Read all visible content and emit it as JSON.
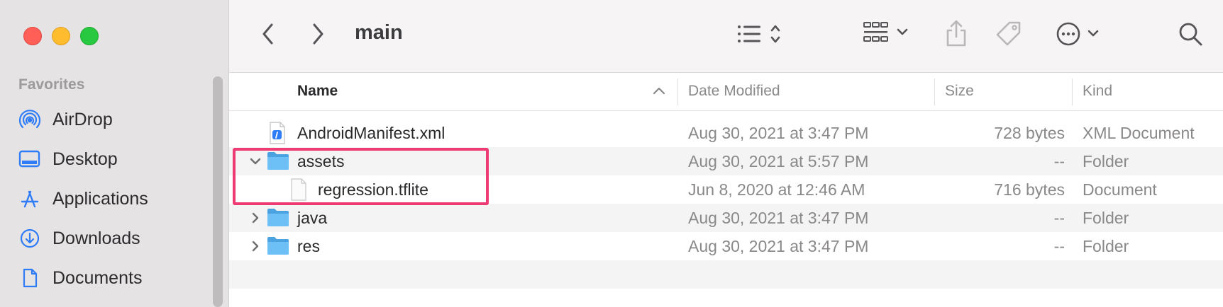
{
  "window": {
    "title": "main"
  },
  "sidebar": {
    "section_title": "Favorites",
    "items": [
      {
        "label": "AirDrop",
        "icon": "airdrop-icon"
      },
      {
        "label": "Desktop",
        "icon": "desktop-icon"
      },
      {
        "label": "Applications",
        "icon": "applications-icon"
      },
      {
        "label": "Downloads",
        "icon": "downloads-icon"
      },
      {
        "label": "Documents",
        "icon": "documents-icon"
      }
    ]
  },
  "toolbar": {
    "back_icon": "chevron-left-icon",
    "forward_icon": "chevron-right-icon",
    "view_icon": "list-view-icon",
    "group_icon": "group-icon",
    "share_icon": "share-icon",
    "tag_icon": "tag-icon",
    "more_icon": "more-icon",
    "search_icon": "search-icon"
  },
  "columns": {
    "name": "Name",
    "date_modified": "Date Modified",
    "size": "Size",
    "kind": "Kind"
  },
  "files": [
    {
      "name": "AndroidManifest.xml",
      "date": "Aug 30, 2021 at 3:47 PM",
      "size": "728 bytes",
      "kind": "XML Document",
      "type": "xml",
      "disclosure": "none",
      "indent": 0
    },
    {
      "name": "assets",
      "date": "Aug 30, 2021 at 5:57 PM",
      "size": "--",
      "kind": "Folder",
      "type": "folder",
      "disclosure": "expanded",
      "indent": 0
    },
    {
      "name": "regression.tflite",
      "date": "Jun 8, 2020 at 12:46 AM",
      "size": "716 bytes",
      "kind": "Document",
      "type": "document",
      "disclosure": "none",
      "indent": 1
    },
    {
      "name": "java",
      "date": "Aug 30, 2021 at 3:47 PM",
      "size": "--",
      "kind": "Folder",
      "type": "folder",
      "disclosure": "collapsed",
      "indent": 0
    },
    {
      "name": "res",
      "date": "Aug 30, 2021 at 3:47 PM",
      "size": "--",
      "kind": "Folder",
      "type": "folder",
      "disclosure": "collapsed",
      "indent": 0
    }
  ],
  "colors": {
    "accent": "#2f7cf6",
    "folder": "#57b3f0",
    "highlight": "#ee3b74"
  }
}
